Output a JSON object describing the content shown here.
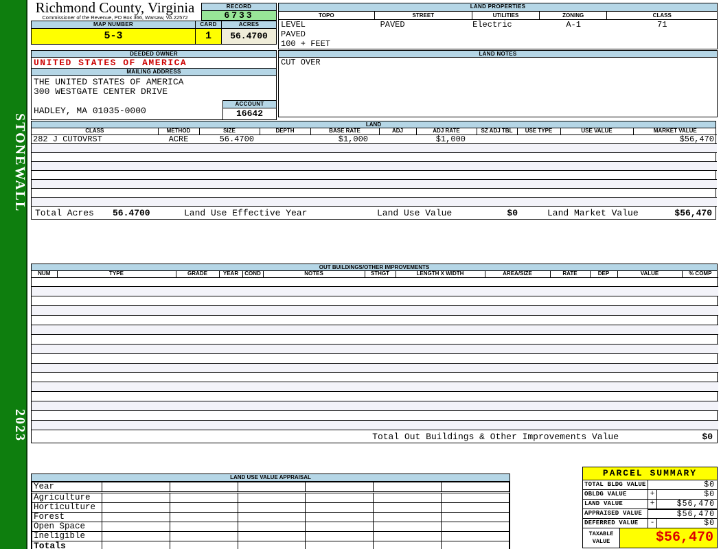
{
  "sidebar": {
    "district": "STONEWALL",
    "year": "2023"
  },
  "header": {
    "county": "Richmond County, Virginia",
    "commissioner": "Commissioner of the Revenue, PO Box 366, Warsaw, VA 22572",
    "record_label": "RECORD",
    "record": "6733",
    "map_number_label": "MAP NUMBER",
    "map_number": "5-3",
    "card_label": "CARD",
    "card": "1",
    "acres_label": "ACRES",
    "acres": "56.4700"
  },
  "land_properties": {
    "title": "LAND PROPERTIES",
    "columns": [
      "TOPO",
      "STREET",
      "UTILITIES",
      "ZONING",
      "CLASS"
    ],
    "values": [
      "LEVEL",
      "PAVED",
      "Electric",
      "A-1",
      "71"
    ],
    "topo_extra": [
      "PAVED",
      "100 + FEET"
    ]
  },
  "owner": {
    "deeded_owner_label": "DEEDED OWNER",
    "name": "UNITED STATES OF AMERICA",
    "mailing_label": "MAILING ADDRESS",
    "address_lines": [
      "THE UNITED STATES OF AMERICA",
      "300 WESTGATE CENTER DRIVE",
      "",
      "HADLEY, MA 01035-0000"
    ],
    "account_label": "ACCOUNT",
    "account": "16642"
  },
  "land_notes": {
    "title": "LAND NOTES",
    "note": "CUT OVER"
  },
  "land": {
    "title": "LAND",
    "columns": [
      "CLASS",
      "METHOD",
      "SIZE",
      "DEPTH",
      "BASE RATE",
      "ADJ",
      "ADJ RATE",
      "SZ ADJ TBL",
      "USE TYPE",
      "USE VALUE",
      "MARKET VALUE"
    ],
    "rows": [
      [
        "282 J CUTOVRST",
        "ACRE",
        "56.4700",
        "",
        "$1,000",
        "",
        "$1,000",
        "",
        "",
        "",
        "$56,470"
      ]
    ],
    "totals": {
      "total_acres_label": "Total Acres",
      "total_acres": "56.4700",
      "effective_year_label": "Land Use Effective Year",
      "land_use_value_label": "Land Use Value",
      "land_use_value": "$0",
      "land_market_value_label": "Land Market Value",
      "land_market_value": "$56,470"
    }
  },
  "out_buildings": {
    "title": "OUT BUILDINGS/OTHER IMPROVEMENTS",
    "columns": [
      "NUM",
      "TYPE",
      "GRADE",
      "YEAR",
      "COND",
      "NOTES",
      "STHGT",
      "LENGTH X WIDTH",
      "AREA/SIZE",
      "RATE",
      "DEP",
      "VALUE",
      "% COMP"
    ],
    "total_label": "Total Out Buildings & Other Improvements Value",
    "total_value": "$0"
  },
  "land_use_appraisal": {
    "title": "LAND USE VALUE APPRAISAL",
    "row_labels": [
      "Year",
      "Agriculture",
      "Horticulture",
      "Forest",
      "Open Space",
      "Ineligible",
      "Totals"
    ]
  },
  "parcel_summary": {
    "title": "PARCEL SUMMARY",
    "rows": [
      {
        "label": "TOTAL BLDG VALUE",
        "op": "",
        "value": "$0"
      },
      {
        "label": "OBLDG VALUE",
        "op": "+",
        "value": "$0"
      },
      {
        "label": "LAND VALUE",
        "op": "+",
        "value": "$56,470"
      },
      {
        "label": "APPRAISED VALUE",
        "op": "",
        "value": "$56,470"
      },
      {
        "label": "DEFERRED VALUE",
        "op": "-",
        "value": "$0"
      }
    ],
    "taxable_label_line1": "TAXABLE",
    "taxable_label_line2": "VALUE",
    "taxable_value": "$56,470"
  },
  "colors": {
    "header_blue": "#b5d6e6",
    "record_green": "#98e698",
    "highlight_yellow": "#ffff00",
    "acres_cream": "#f0edd9",
    "sidebar_green": "#0e7e0e",
    "alert_red": "#cc0000"
  }
}
